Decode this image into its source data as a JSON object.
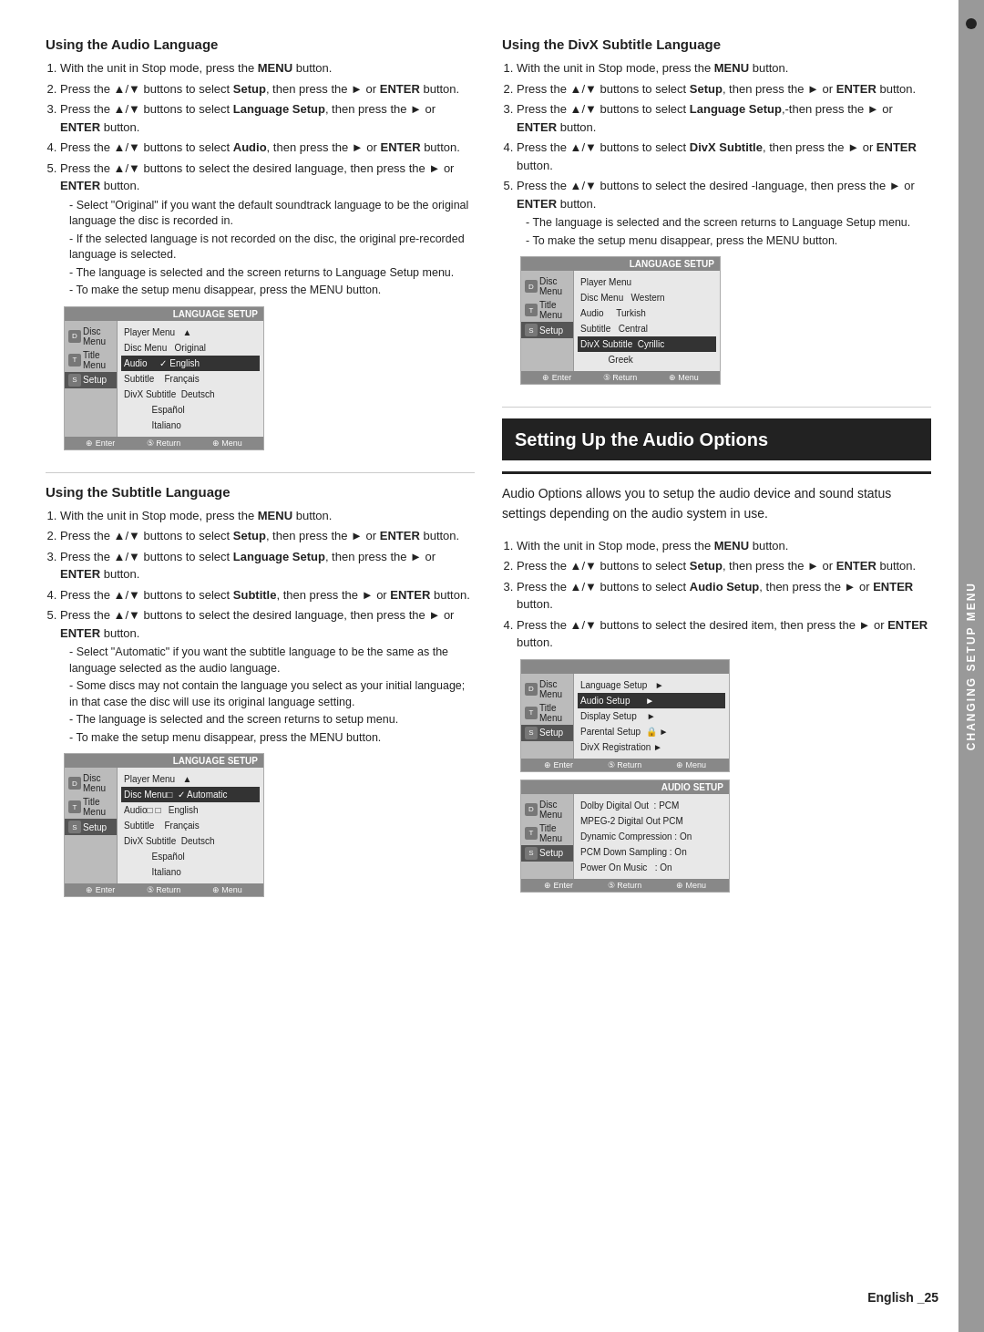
{
  "sidebar": {
    "label": "CHANGING SETUP MENU",
    "dot": true
  },
  "page_footer": "English _25",
  "section_audio_language": {
    "title": "Using the Audio Language",
    "steps": [
      "With the unit in Stop mode, press the <b>MENU</b> button.",
      "Press the ▲/▼ buttons to select <b>Setup</b>, then press the ► or <b>ENTER</b> button.",
      "Press the ▲/▼ buttons to select <b>Language Setup</b>, then press the ► or <b>ENTER</b> button.",
      "Press the ▲/▼ buttons to select <b>Audio</b>, then press the ► or <b>ENTER</b> button.",
      "Press the ▲/▼ buttons to select the desired language, then press the ► or <b>ENTER</b> button."
    ],
    "sub_notes": [
      "Select \"Original\" if you want the default soundtrack language to be the original language the disc is recorded in.",
      "If the selected language is not recorded on the disc, the original pre-recorded language is selected.",
      "The language is selected and the screen returns to Language Setup menu.",
      "To make the setup menu disappear, press the MENU button."
    ],
    "screen": {
      "header": "LANGUAGE SETUP",
      "left_items": [
        {
          "label": "Disc Menu",
          "active": false
        },
        {
          "label": "Title Menu",
          "active": false
        },
        {
          "label": "Setup",
          "active": true
        }
      ],
      "right_items": [
        {
          "label": "Player Menu",
          "value": "▲"
        },
        {
          "label": "Disc Menu",
          "value": "Original"
        },
        {
          "label": "Audio",
          "value": "✓ English"
        },
        {
          "label": "Subtitle",
          "value": "Français"
        },
        {
          "label": "DivX Subtitle",
          "value": "Deutsch"
        },
        {
          "label": "",
          "value": "Español"
        },
        {
          "label": "",
          "value": "Italiano"
        }
      ],
      "footer": "⊕ Enter  ⑤ Return  ⊕ Menu"
    }
  },
  "section_divx_subtitle": {
    "title": "Using the DivX Subtitle Language",
    "steps": [
      "With the unit in Stop mode, press the <b>MENU</b> button.",
      "Press the ▲/▼ buttons to select <b>Setup</b>, then press the ► or <b>ENTER</b> button.",
      "Press the ▲/▼ buttons to select <b>Language Setup</b>,-then press the ► or <b>ENTER</b> button.",
      "Press the ▲/▼ buttons to select <b>DivX Subtitle</b>, then press the ► or <b>ENTER</b> button.",
      "Press the ▲/▼ buttons to select the desired -language, then press the ► or <b>ENTER</b> button."
    ],
    "sub_notes": [
      "The language is selected and the screen returns to Language Setup menu.",
      "To make the setup menu disappear, press the MENU button."
    ],
    "screen": {
      "header": "LANGUAGE SETUP",
      "left_items": [
        {
          "label": "Disc Menu",
          "active": false
        },
        {
          "label": "Title Menu",
          "active": false
        },
        {
          "label": "Setup",
          "active": true
        }
      ],
      "right_items": [
        {
          "label": "Player Menu",
          "value": ""
        },
        {
          "label": "Disc Menu",
          "value": "Western"
        },
        {
          "label": "Audio",
          "value": "Turkish"
        },
        {
          "label": "Subtitle",
          "value": "Central"
        },
        {
          "label": "DivX Subtitle",
          "value": "Cyrillic",
          "highlighted": true
        },
        {
          "label": "",
          "value": "Greek"
        }
      ],
      "footer": "⊕ Enter  ⑤ Return  ⊕ Menu"
    }
  },
  "section_subtitle_language": {
    "title": "Using the Subtitle Language",
    "steps": [
      "With the unit in Stop mode, press the <b>MENU</b> button.",
      "Press the ▲/▼ buttons to select <b>Setup</b>, then press the ► or <b>ENTER</b> button.",
      "Press the ▲/▼ buttons to select <b>Language Setup</b>, then press the ► or <b>ENTER</b> button.",
      "Press the ▲/▼ buttons to select <b>Subtitle</b>, then press the ► or <b>ENTER</b> button.",
      "Press the ▲/▼ buttons to select the desired language, then press the ► or <b>ENTER</b> button."
    ],
    "sub_notes": [
      "Select \"Automatic\" if you want the subtitle language to be the same as the language selected as the audio language.",
      "Some discs may not contain the language you select as your initial language; in that case the disc will use its original language setting.",
      "The language is selected and the screen returns to setup menu.",
      "To make the setup menu disappear, press the MENU button."
    ],
    "screen": {
      "header": "LANGUAGE SETUP",
      "left_items": [
        {
          "label": "Disc Menu",
          "active": false
        },
        {
          "label": "Title Menu",
          "active": false
        },
        {
          "label": "Setup",
          "active": true
        }
      ],
      "right_items": [
        {
          "label": "Player Menu",
          "value": "▲"
        },
        {
          "label": "Disc Menu□",
          "value": "✓ Automatic",
          "highlighted": true
        },
        {
          "label": "Audio□  □",
          "value": "English"
        },
        {
          "label": "Subtitle",
          "value": "Français"
        },
        {
          "label": "DivX Subtitle",
          "value": "Deutsch"
        },
        {
          "label": "",
          "value": "Español"
        },
        {
          "label": "",
          "value": "Italiano"
        }
      ],
      "footer": "⊕ Enter  ⑤ Return  ⊕ Menu"
    }
  },
  "section_audio_options": {
    "title": "Setting Up the Audio Options",
    "description": "Audio Options allows you to setup the audio device and sound status settings depending on the audio system in use.",
    "steps": [
      "With the unit in Stop mode, press the <b>MENU</b> button.",
      "Press the ▲/▼ buttons to select <b>Setup</b>, then press the ► or <b>ENTER</b> button.",
      "Press the ▲/▼ buttons to select <b>Audio Setup</b>, then press the ► or <b>ENTER</b> button.",
      "Press the ▲/▼ buttons to select the desired item, then press the ► or <b>ENTER</b> button."
    ],
    "screen_setup": {
      "header": "",
      "left_items": [
        {
          "label": "Disc Menu",
          "active": false
        },
        {
          "label": "Title Menu",
          "active": false
        },
        {
          "label": "Setup",
          "active": true
        }
      ],
      "right_items": [
        {
          "label": "Language Setup",
          "value": "►"
        },
        {
          "label": "Audio Setup",
          "value": "►",
          "highlighted": true
        },
        {
          "label": "Display Setup",
          "value": "►"
        },
        {
          "label": "Parental Setup",
          "value": "🔒 ►"
        },
        {
          "label": "DivX Registration",
          "value": "►"
        }
      ],
      "footer": "⊕ Enter  ⑤ Return  ⊕ Menu"
    },
    "screen_audio": {
      "header": "AUDIO SETUP",
      "left_items": [
        {
          "label": "Disc Menu",
          "active": false
        },
        {
          "label": "Title Menu",
          "active": false
        },
        {
          "label": "Setup",
          "active": true
        }
      ],
      "right_items": [
        {
          "label": "Dolby Digital Out",
          "value": ": PCM"
        },
        {
          "label": "MPEG-2 Digital Out",
          "value": "PCM"
        },
        {
          "label": "Dynamic Compression",
          "value": ": On"
        },
        {
          "label": "PCM Down Sampling",
          "value": ": On"
        },
        {
          "label": "Power On Music",
          "value": ": On"
        }
      ],
      "footer": "⊕ Enter  ⑤ Return  ⊕ Menu"
    }
  }
}
